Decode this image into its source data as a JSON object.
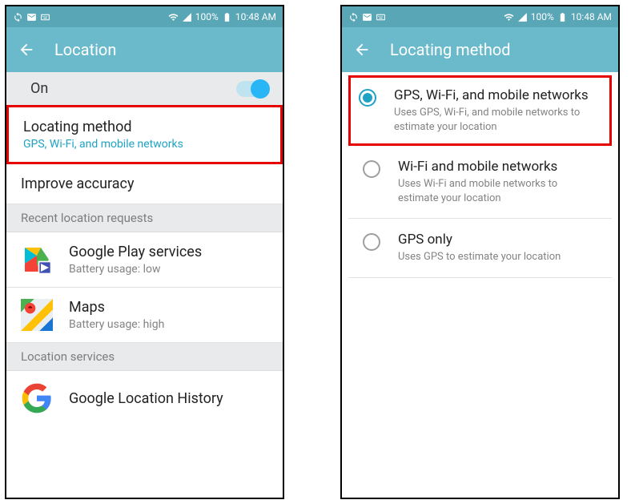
{
  "statusbar": {
    "signal": "100%",
    "time": "10:48 AM"
  },
  "left": {
    "title": "Location",
    "on_label": "On",
    "locating_method": {
      "title": "Locating method",
      "sub": "GPS, Wi-Fi, and mobile networks"
    },
    "improve_accuracy": "Improve accuracy",
    "section_recent": "Recent location requests",
    "play_services": {
      "title": "Google Play services",
      "sub": "Battery usage: low"
    },
    "maps": {
      "title": "Maps",
      "sub": "Battery usage: high"
    },
    "section_services": "Location services",
    "location_history": "Google Location History"
  },
  "right": {
    "title": "Locating method",
    "options": [
      {
        "title": "GPS, Wi-Fi, and mobile networks",
        "sub": "Uses GPS, Wi-Fi, and mobile networks to estimate your location"
      },
      {
        "title": "Wi-Fi and mobile networks",
        "sub": "Uses Wi-Fi and mobile networks to estimate your location"
      },
      {
        "title": "GPS only",
        "sub": "Uses GPS to estimate your location"
      }
    ]
  }
}
